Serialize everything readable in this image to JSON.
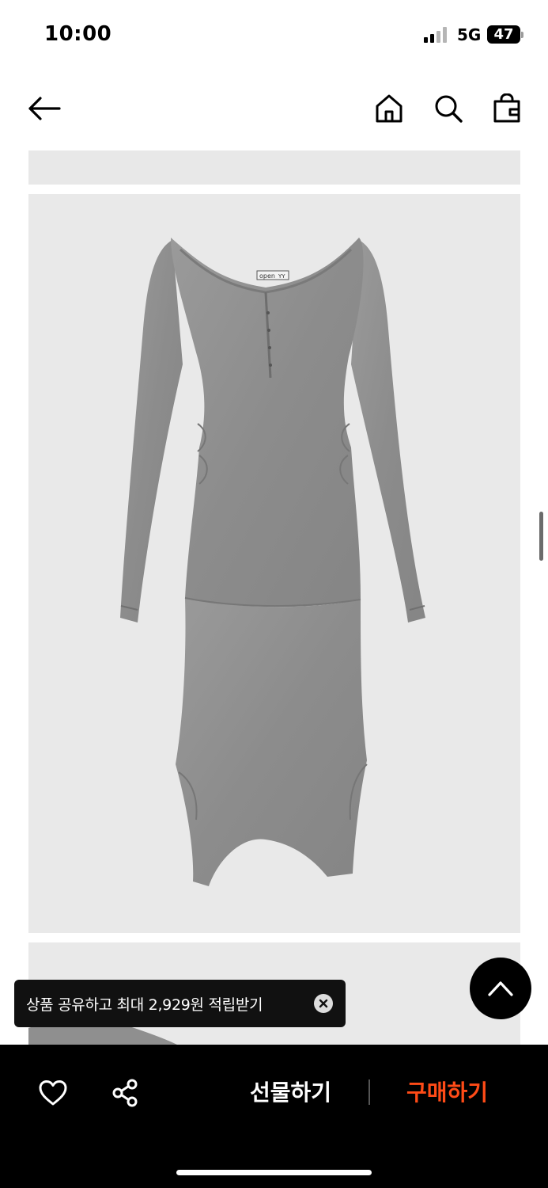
{
  "status_bar": {
    "time": "10:00",
    "network": "5G",
    "battery": "47"
  },
  "product": {
    "label_brand_left": "open",
    "label_brand_right": "YY"
  },
  "toast": {
    "message": "상품 공유하고 최대 2,929원 적립받기"
  },
  "bottom_bar": {
    "gift_label": "선물하기",
    "buy_label": "구매하기"
  },
  "colors": {
    "buy_accent": "#ff4b17",
    "image_bg": "#e9e9e9",
    "dress_gray": "#8e8e8e"
  },
  "icons": [
    "back-arrow-icon",
    "home-icon",
    "search-icon",
    "shopping-bag-icon",
    "heart-icon",
    "share-icon",
    "chevron-up-icon",
    "close-icon"
  ]
}
